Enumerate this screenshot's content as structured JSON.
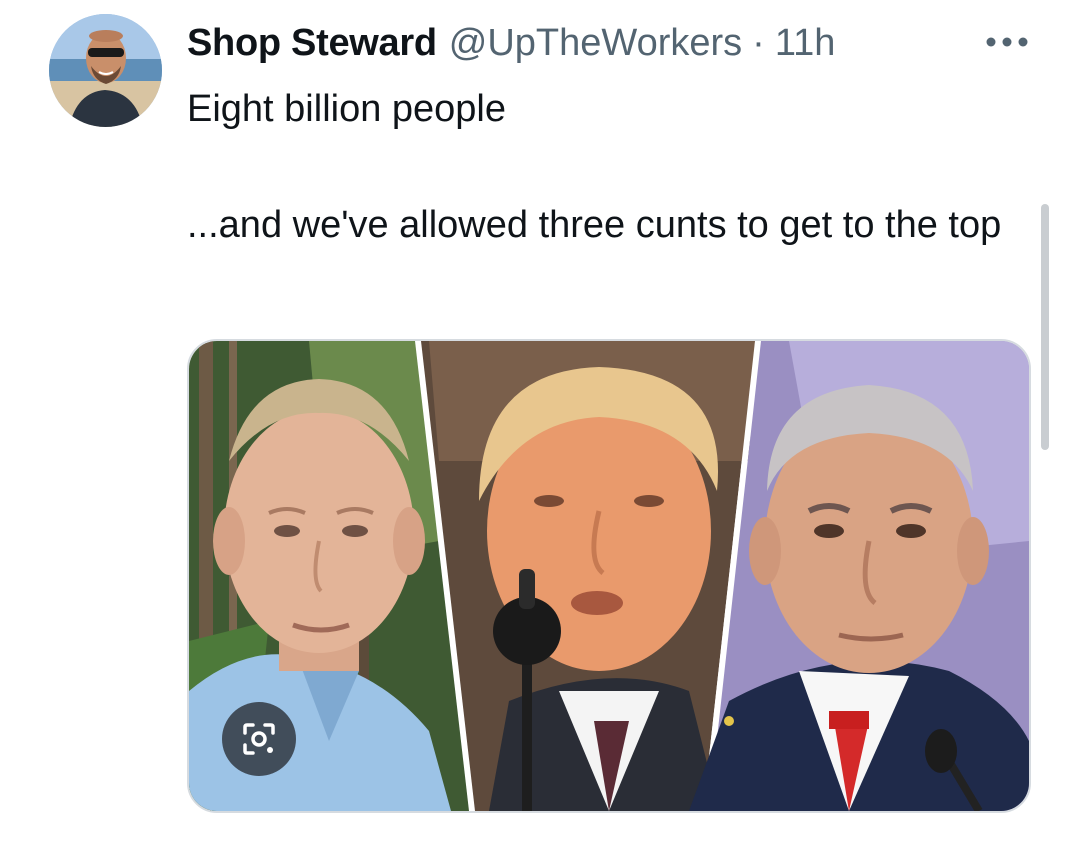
{
  "tweet": {
    "author": {
      "display_name": "Shop Steward",
      "handle": "@UpTheWorkers"
    },
    "separator": "·",
    "timestamp": "11h",
    "text_lines": [
      "Eight billion people",
      "...and we've allowed three cunts to get to the top"
    ],
    "media": {
      "panels": [
        "portrait-left",
        "portrait-center",
        "portrait-right"
      ],
      "overlay_icon": "visual-search-lens-icon"
    },
    "more_icon": "more-horizontal-icon"
  },
  "colors": {
    "text_primary": "#0f1419",
    "text_secondary": "#536471",
    "media_border": "#d6dbe0",
    "scrollbar": "#c9cdd1"
  }
}
